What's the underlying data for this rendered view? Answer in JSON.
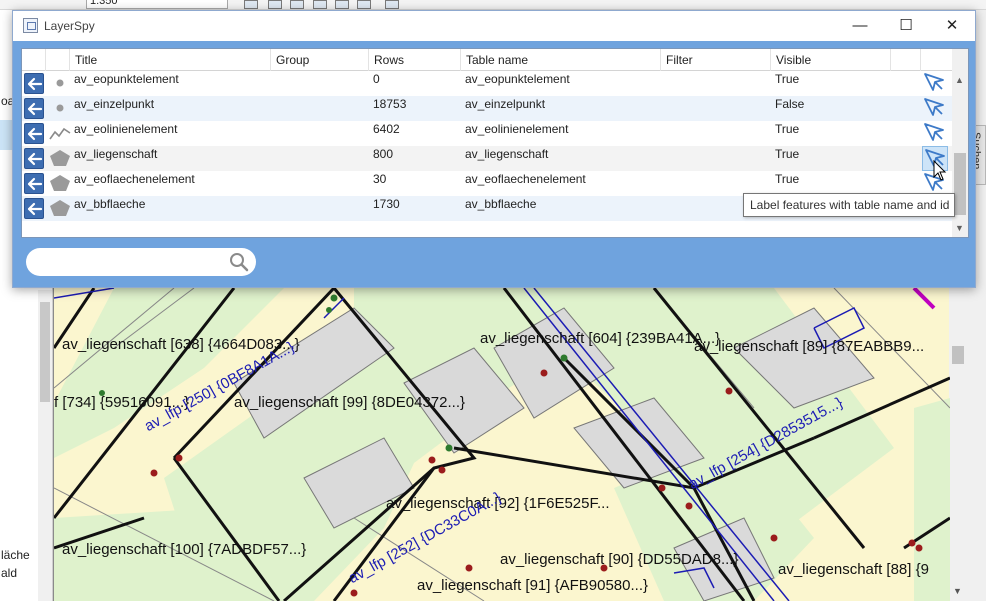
{
  "background_app": {
    "scale": "1:350",
    "left_panel_texts": [
      "oac",
      "läche",
      "ald"
    ]
  },
  "layerspy": {
    "title": "LayerSpy",
    "columns": [
      "Title",
      "Group",
      "Rows",
      "Table name",
      "Filter",
      "Visible"
    ],
    "rows": [
      {
        "title": "av_eopunktelement",
        "group": "",
        "rows": "0",
        "table_name": "av_eopunktelement",
        "filter": "",
        "visible": "True",
        "geom": "point"
      },
      {
        "title": "av_einzelpunkt",
        "group": "",
        "rows": "18753",
        "table_name": "av_einzelpunkt",
        "filter": "",
        "visible": "False",
        "geom": "point"
      },
      {
        "title": "av_eolinienelement",
        "group": "",
        "rows": "6402",
        "table_name": "av_eolinienelement",
        "filter": "",
        "visible": "True",
        "geom": "line"
      },
      {
        "title": "av_liegenschaft",
        "group": "",
        "rows": "800",
        "table_name": "av_liegenschaft",
        "filter": "",
        "visible": "True",
        "geom": "polygon"
      },
      {
        "title": "av_eoflaechenelement",
        "group": "",
        "rows": "30",
        "table_name": "av_eoflaechenelement",
        "filter": "",
        "visible": "True",
        "geom": "polygon"
      },
      {
        "title": "av_bbflaeche",
        "group": "",
        "rows": "1730",
        "table_name": "av_bbflaeche",
        "filter": "",
        "visible": "True",
        "geom": "polygon"
      }
    ],
    "search": {
      "value": "",
      "placeholder": ""
    },
    "tooltip": "Label features with table name and id"
  },
  "map": {
    "labels": [
      "av_liegenschaft [638] {4664D083...}",
      "av_liegenschaft [604] {239BA41A...}",
      "av_liegenschaft [89] {87EABBB9...",
      "f [734] {59516091...}",
      "av_liegenschaft [99] {8DE04372...}",
      "av_liegenschaft [92] {1F6E525F...",
      "av_liegenschaft [100] {7ADBDF57...}",
      "av_liegenschaft [90] {DD55DAD8...}",
      "av_liegenschaft [88] {9",
      "av_liegenschaft [91] {AFB90580...}",
      "av_lfp [250] {0BF8A1A...}",
      "av_lfp [254] {D2853515...}",
      "av_lfp [252] {DC33C0A...}"
    ]
  },
  "colors": {
    "accent_panel": "#6fa3de",
    "row_button": "#3d6db1",
    "map_yellow": "#fbf6cf",
    "map_green": "#dff2cc",
    "map_gray": "#dadada",
    "fixpoint_blue": "#1c1cb4"
  }
}
